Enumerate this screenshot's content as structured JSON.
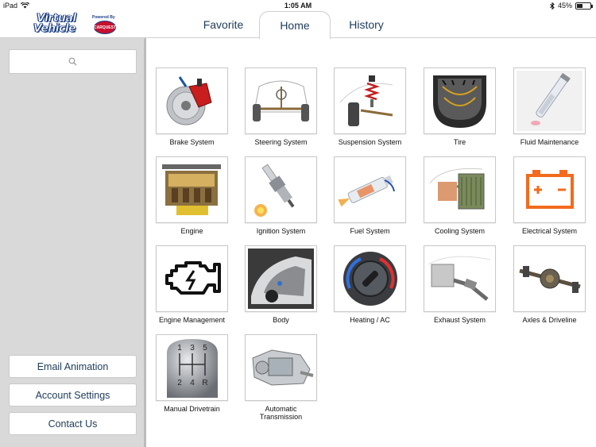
{
  "status_bar": {
    "device": "iPad",
    "time": "1:05 AM",
    "battery": "45%",
    "battery_level": 0.45
  },
  "logo": {
    "line1": "Virtual",
    "line2": "Vehicle",
    "powered_by": "Powered By",
    "partner": "CARQUEST"
  },
  "tabs": [
    {
      "label": "Favorite",
      "active": false
    },
    {
      "label": "Home",
      "active": true
    },
    {
      "label": "History",
      "active": false
    }
  ],
  "search": {
    "placeholder": ""
  },
  "sidebar_buttons": [
    {
      "label": "Email Animation"
    },
    {
      "label": "Account Settings"
    },
    {
      "label": "Contact Us"
    }
  ],
  "systems": [
    {
      "label": "Brake System",
      "icon": "brake-icon"
    },
    {
      "label": "Steering System",
      "icon": "steering-icon"
    },
    {
      "label": "Suspension System",
      "icon": "suspension-icon"
    },
    {
      "label": "Tire",
      "icon": "tire-icon"
    },
    {
      "label": "Fluid Maintenance",
      "icon": "fluid-icon"
    },
    {
      "label": "Engine",
      "icon": "engine-icon"
    },
    {
      "label": "Ignition System",
      "icon": "spark-plug-icon"
    },
    {
      "label": "Fuel System",
      "icon": "fuel-injector-icon"
    },
    {
      "label": "Cooling System",
      "icon": "cooling-icon"
    },
    {
      "label": "Electrical System",
      "icon": "battery-icon"
    },
    {
      "label": "Engine Management",
      "icon": "check-engine-icon"
    },
    {
      "label": "Body",
      "icon": "body-icon"
    },
    {
      "label": "Heating / AC",
      "icon": "climate-knob-icon"
    },
    {
      "label": "Exhaust System",
      "icon": "exhaust-icon"
    },
    {
      "label": "Axles & Driveline",
      "icon": "axle-icon"
    },
    {
      "label": "Manual Drivetrain",
      "icon": "gear-shifter-icon"
    },
    {
      "label": "Automatic Transmission",
      "icon": "transmission-icon"
    }
  ],
  "shifter_pattern": {
    "top": [
      "1",
      "3",
      "5"
    ],
    "bottom": [
      "2",
      "4",
      "R"
    ]
  },
  "colors": {
    "accent_text": "#1d3b5a",
    "sidebar_bg": "#d9d9d9",
    "battery_orange": "#f26b1d"
  }
}
